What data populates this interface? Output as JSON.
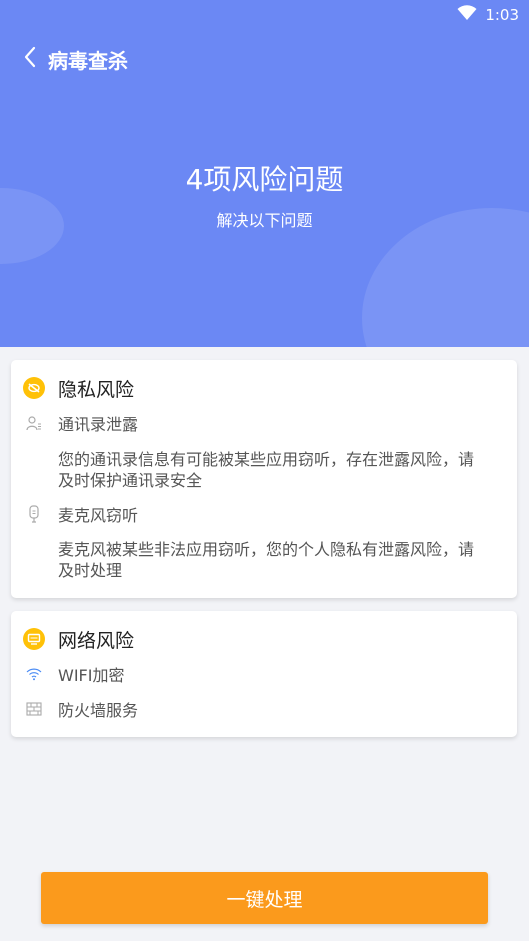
{
  "status_bar": {
    "time": "1:03"
  },
  "header": {
    "title": "病毒查杀",
    "risk_summary": "4项风险问题",
    "subtitle": "解决以下问题"
  },
  "privacy_card": {
    "title": "隐私风险",
    "items": [
      {
        "label": "通讯录泄露",
        "description": "您的通讯录信息有可能被某些应用窃听，存在泄露风险，请及时保护通讯录安全"
      },
      {
        "label": "麦克风窃听",
        "description": "麦克风被某些非法应用窃听，您的个人隐私有泄露风险，请及时处理"
      }
    ]
  },
  "network_card": {
    "title": "网络风险",
    "items": [
      {
        "label": "WIFI加密"
      },
      {
        "label": "防火墙服务"
      }
    ]
  },
  "action_button": {
    "label": "一键处理"
  },
  "colors": {
    "header_bg": "#6b88f4",
    "badge": "#ffc107",
    "button": "#fb9a1c"
  }
}
